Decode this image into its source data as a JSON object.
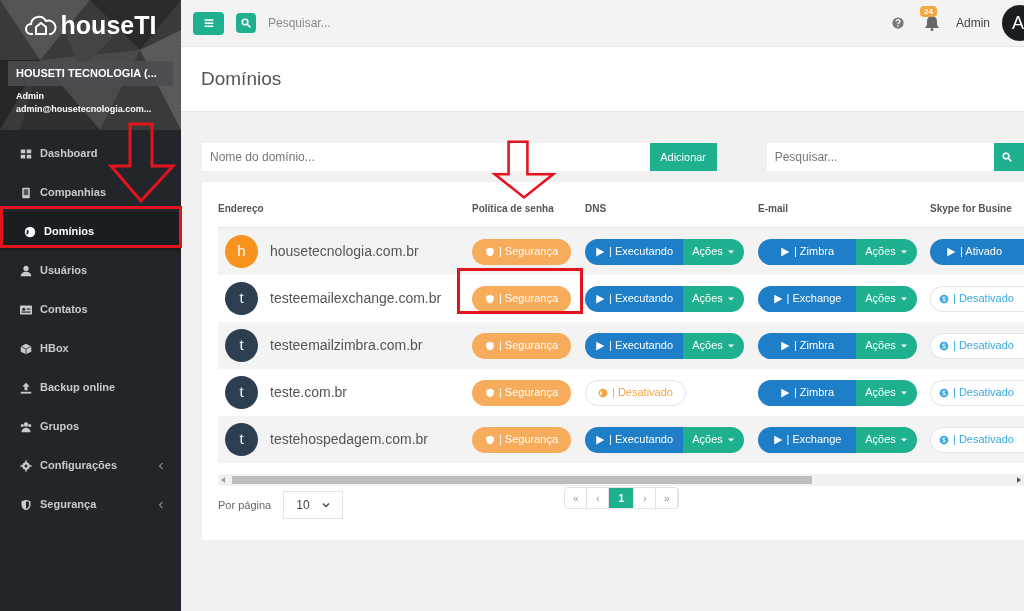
{
  "sidebar": {
    "logo": "houseTI",
    "company": "HOUSETI TECNOLOGIA (...",
    "user_name": "Admin",
    "user_email": "admin@housetecnologia.com...",
    "items": [
      {
        "label": "Dashboard",
        "kind": "link",
        "selected": false
      },
      {
        "label": "Companhias",
        "kind": "link",
        "selected": false
      },
      {
        "label": "Domínios",
        "kind": "link",
        "selected": true
      },
      {
        "label": "Usuários",
        "kind": "link",
        "selected": false
      },
      {
        "label": "Contatos",
        "kind": "link",
        "selected": false
      },
      {
        "label": "HBox",
        "kind": "link",
        "selected": false
      },
      {
        "label": "Backup online",
        "kind": "link",
        "selected": false
      },
      {
        "label": "Grupos",
        "kind": "link",
        "selected": false
      },
      {
        "label": "Configurações",
        "kind": "group",
        "selected": false
      },
      {
        "label": "Segurança",
        "kind": "group",
        "selected": false
      }
    ]
  },
  "topbar": {
    "search_placeholder": "Pesquisar...",
    "notification_count": "24",
    "user": "Admin",
    "avatar": "A"
  },
  "page_title": "Domínios",
  "toolbar": {
    "domain_placeholder": "Nome do domínio...",
    "add_button": "Adicionar",
    "search_placeholder": "Pesquisar..."
  },
  "table": {
    "columns": [
      "Endereço",
      "Política de senha",
      "DNS",
      "E-mail",
      "Skype for Busine"
    ],
    "rows": [
      {
        "avatar": "h",
        "color": "#f7931e",
        "domain": "housetecnologia.com.br",
        "policy": "| Segurança",
        "dns": {
          "kind": "running",
          "label": "| Executando",
          "actions": "Ações"
        },
        "email": {
          "label": "| Zimbra",
          "actions": "Ações"
        },
        "skype": {
          "kind": "enabled",
          "label": "| Ativado"
        }
      },
      {
        "avatar": "t",
        "color": "#2c3e50",
        "domain": "testeemailexchange.com.br",
        "policy": "| Segurança",
        "dns": {
          "kind": "running",
          "label": "| Executando",
          "actions": "Ações"
        },
        "email": {
          "label": "| Exchange",
          "actions": "Ações"
        },
        "skype": {
          "kind": "disabled",
          "label": "| Desativado"
        }
      },
      {
        "avatar": "t",
        "color": "#2c3e50",
        "domain": "testeemailzimbra.com.br",
        "policy": "| Segurança",
        "dns": {
          "kind": "running",
          "label": "| Executando",
          "actions": "Ações"
        },
        "email": {
          "label": "| Zimbra",
          "actions": "Ações"
        },
        "skype": {
          "kind": "disabled",
          "label": "| Desativado"
        }
      },
      {
        "avatar": "t",
        "color": "#2c3e50",
        "domain": "teste.com.br",
        "policy": "| Segurança",
        "dns": {
          "kind": "disabled",
          "label": "| Desativado"
        },
        "email": {
          "label": "| Zimbra",
          "actions": "Ações"
        },
        "skype": {
          "kind": "disabled",
          "label": "| Desativado"
        }
      },
      {
        "avatar": "t",
        "color": "#2c3e50",
        "domain": "testehospedagem.com.br",
        "policy": "| Segurança",
        "dns": {
          "kind": "running",
          "label": "| Executando",
          "actions": "Ações"
        },
        "email": {
          "label": "| Exchange",
          "actions": "Ações"
        },
        "skype": {
          "kind": "disabled",
          "label": "| Desativado"
        }
      }
    ]
  },
  "footer": {
    "per_page_label": "Por página",
    "per_page": "10",
    "pages": [
      {
        "label": "«",
        "selected": false
      },
      {
        "label": "‹",
        "selected": false
      },
      {
        "label": "1",
        "selected": true
      },
      {
        "label": "›",
        "selected": false
      },
      {
        "label": "»",
        "selected": false
      }
    ]
  }
}
